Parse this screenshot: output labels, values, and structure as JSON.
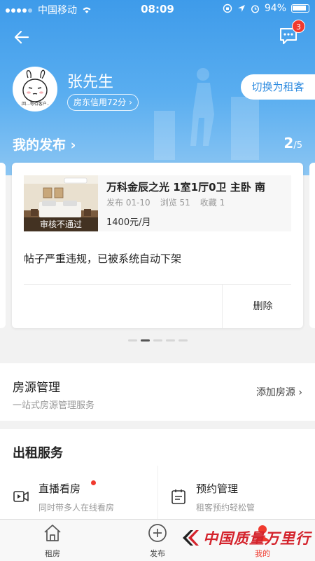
{
  "status_bar": {
    "carrier": "中国移动",
    "time": "08:09",
    "battery": "94%"
  },
  "header": {
    "message_badge_count": "3",
    "username": "张先生",
    "credit_label": "房东信用72分 ›",
    "switch_role_label": "切换为租客",
    "avatar_caption": "..回...等待客户..."
  },
  "my_posts": {
    "title": "我的发布 ›",
    "current": "2",
    "total": "/5"
  },
  "listing": {
    "title": "万科金辰之光 1室1厅0卫 主卧 南",
    "published_label": "发布 01-10",
    "views_label": "浏览 51",
    "favorites_label": "收藏 1",
    "price": "1400元/月",
    "review_status": "审核不通过",
    "notice": "帖子严重违规，已被系统自动下架",
    "delete_label": "删除"
  },
  "pager": {
    "count": 5,
    "active_index": 1
  },
  "property_management": {
    "title": "房源管理",
    "subtitle": "一站式房源管理服务",
    "action_label": "添加房源 ›"
  },
  "rental_services": {
    "heading": "出租服务",
    "items": [
      {
        "title": "直播看房",
        "subtitle": "同时带多人在线看房",
        "icon": "video-icon",
        "has_red_dot": true
      },
      {
        "title": "预约管理",
        "subtitle": "租客预约轻松管",
        "icon": "calendar-icon",
        "has_red_dot": false
      }
    ]
  },
  "tabbar": {
    "items": [
      {
        "label": "租房",
        "icon": "house-icon"
      },
      {
        "label": "发布",
        "icon": "plus-circle-icon"
      },
      {
        "label": "我的",
        "icon": "user-icon",
        "active": true
      }
    ]
  },
  "watermark": {
    "text": "中国质量万里行"
  },
  "colors": {
    "brand_blue": "#3e9bea",
    "accent_red": "#f03a2e",
    "switch_text": "#2e8be0"
  }
}
